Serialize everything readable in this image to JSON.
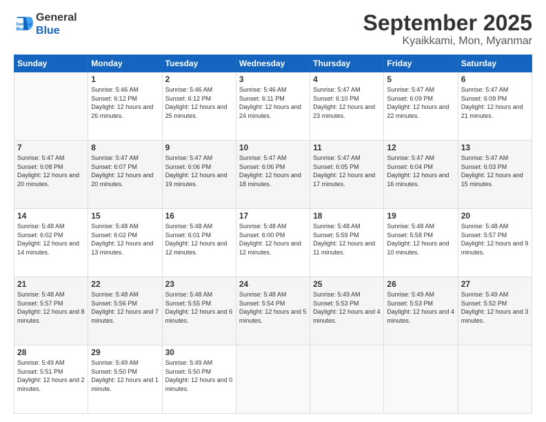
{
  "logo": {
    "line1": "General",
    "line2": "Blue"
  },
  "title": "September 2025",
  "subtitle": "Kyaikkami, Mon, Myanmar",
  "days_of_week": [
    "Sunday",
    "Monday",
    "Tuesday",
    "Wednesday",
    "Thursday",
    "Friday",
    "Saturday"
  ],
  "weeks": [
    [
      {
        "day": "",
        "sunrise": "",
        "sunset": "",
        "daylight": ""
      },
      {
        "day": "1",
        "sunrise": "Sunrise: 5:46 AM",
        "sunset": "Sunset: 6:12 PM",
        "daylight": "Daylight: 12 hours and 26 minutes."
      },
      {
        "day": "2",
        "sunrise": "Sunrise: 5:46 AM",
        "sunset": "Sunset: 6:12 PM",
        "daylight": "Daylight: 12 hours and 25 minutes."
      },
      {
        "day": "3",
        "sunrise": "Sunrise: 5:46 AM",
        "sunset": "Sunset: 6:11 PM",
        "daylight": "Daylight: 12 hours and 24 minutes."
      },
      {
        "day": "4",
        "sunrise": "Sunrise: 5:47 AM",
        "sunset": "Sunset: 6:10 PM",
        "daylight": "Daylight: 12 hours and 23 minutes."
      },
      {
        "day": "5",
        "sunrise": "Sunrise: 5:47 AM",
        "sunset": "Sunset: 6:09 PM",
        "daylight": "Daylight: 12 hours and 22 minutes."
      },
      {
        "day": "6",
        "sunrise": "Sunrise: 5:47 AM",
        "sunset": "Sunset: 6:09 PM",
        "daylight": "Daylight: 12 hours and 21 minutes."
      }
    ],
    [
      {
        "day": "7",
        "sunrise": "Sunrise: 5:47 AM",
        "sunset": "Sunset: 6:08 PM",
        "daylight": "Daylight: 12 hours and 20 minutes."
      },
      {
        "day": "8",
        "sunrise": "Sunrise: 5:47 AM",
        "sunset": "Sunset: 6:07 PM",
        "daylight": "Daylight: 12 hours and 20 minutes."
      },
      {
        "day": "9",
        "sunrise": "Sunrise: 5:47 AM",
        "sunset": "Sunset: 6:06 PM",
        "daylight": "Daylight: 12 hours and 19 minutes."
      },
      {
        "day": "10",
        "sunrise": "Sunrise: 5:47 AM",
        "sunset": "Sunset: 6:06 PM",
        "daylight": "Daylight: 12 hours and 18 minutes."
      },
      {
        "day": "11",
        "sunrise": "Sunrise: 5:47 AM",
        "sunset": "Sunset: 6:05 PM",
        "daylight": "Daylight: 12 hours and 17 minutes."
      },
      {
        "day": "12",
        "sunrise": "Sunrise: 5:47 AM",
        "sunset": "Sunset: 6:04 PM",
        "daylight": "Daylight: 12 hours and 16 minutes."
      },
      {
        "day": "13",
        "sunrise": "Sunrise: 5:47 AM",
        "sunset": "Sunset: 6:03 PM",
        "daylight": "Daylight: 12 hours and 15 minutes."
      }
    ],
    [
      {
        "day": "14",
        "sunrise": "Sunrise: 5:48 AM",
        "sunset": "Sunset: 6:02 PM",
        "daylight": "Daylight: 12 hours and 14 minutes."
      },
      {
        "day": "15",
        "sunrise": "Sunrise: 5:48 AM",
        "sunset": "Sunset: 6:02 PM",
        "daylight": "Daylight: 12 hours and 13 minutes."
      },
      {
        "day": "16",
        "sunrise": "Sunrise: 5:48 AM",
        "sunset": "Sunset: 6:01 PM",
        "daylight": "Daylight: 12 hours and 12 minutes."
      },
      {
        "day": "17",
        "sunrise": "Sunrise: 5:48 AM",
        "sunset": "Sunset: 6:00 PM",
        "daylight": "Daylight: 12 hours and 12 minutes."
      },
      {
        "day": "18",
        "sunrise": "Sunrise: 5:48 AM",
        "sunset": "Sunset: 5:59 PM",
        "daylight": "Daylight: 12 hours and 11 minutes."
      },
      {
        "day": "19",
        "sunrise": "Sunrise: 5:48 AM",
        "sunset": "Sunset: 5:58 PM",
        "daylight": "Daylight: 12 hours and 10 minutes."
      },
      {
        "day": "20",
        "sunrise": "Sunrise: 5:48 AM",
        "sunset": "Sunset: 5:57 PM",
        "daylight": "Daylight: 12 hours and 9 minutes."
      }
    ],
    [
      {
        "day": "21",
        "sunrise": "Sunrise: 5:48 AM",
        "sunset": "Sunset: 5:57 PM",
        "daylight": "Daylight: 12 hours and 8 minutes."
      },
      {
        "day": "22",
        "sunrise": "Sunrise: 5:48 AM",
        "sunset": "Sunset: 5:56 PM",
        "daylight": "Daylight: 12 hours and 7 minutes."
      },
      {
        "day": "23",
        "sunrise": "Sunrise: 5:48 AM",
        "sunset": "Sunset: 5:55 PM",
        "daylight": "Daylight: 12 hours and 6 minutes."
      },
      {
        "day": "24",
        "sunrise": "Sunrise: 5:48 AM",
        "sunset": "Sunset: 5:54 PM",
        "daylight": "Daylight: 12 hours and 5 minutes."
      },
      {
        "day": "25",
        "sunrise": "Sunrise: 5:49 AM",
        "sunset": "Sunset: 5:53 PM",
        "daylight": "Daylight: 12 hours and 4 minutes."
      },
      {
        "day": "26",
        "sunrise": "Sunrise: 5:49 AM",
        "sunset": "Sunset: 5:53 PM",
        "daylight": "Daylight: 12 hours and 4 minutes."
      },
      {
        "day": "27",
        "sunrise": "Sunrise: 5:49 AM",
        "sunset": "Sunset: 5:52 PM",
        "daylight": "Daylight: 12 hours and 3 minutes."
      }
    ],
    [
      {
        "day": "28",
        "sunrise": "Sunrise: 5:49 AM",
        "sunset": "Sunset: 5:51 PM",
        "daylight": "Daylight: 12 hours and 2 minutes."
      },
      {
        "day": "29",
        "sunrise": "Sunrise: 5:49 AM",
        "sunset": "Sunset: 5:50 PM",
        "daylight": "Daylight: 12 hours and 1 minute."
      },
      {
        "day": "30",
        "sunrise": "Sunrise: 5:49 AM",
        "sunset": "Sunset: 5:50 PM",
        "daylight": "Daylight: 12 hours and 0 minutes."
      },
      {
        "day": "",
        "sunrise": "",
        "sunset": "",
        "daylight": ""
      },
      {
        "day": "",
        "sunrise": "",
        "sunset": "",
        "daylight": ""
      },
      {
        "day": "",
        "sunrise": "",
        "sunset": "",
        "daylight": ""
      },
      {
        "day": "",
        "sunrise": "",
        "sunset": "",
        "daylight": ""
      }
    ]
  ]
}
